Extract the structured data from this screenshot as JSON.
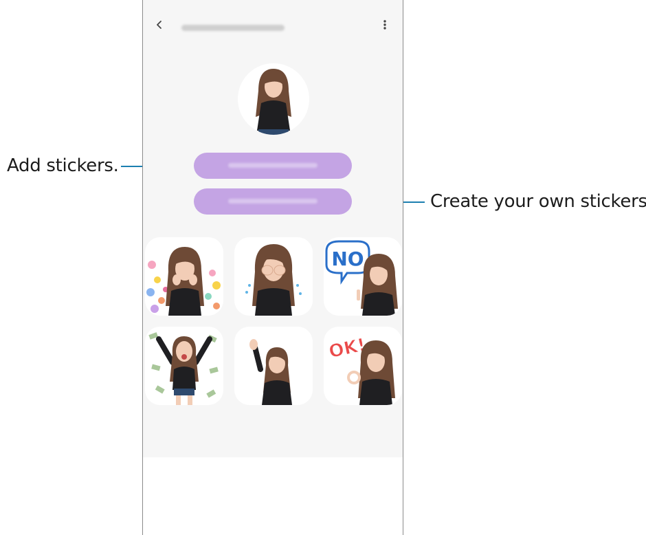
{
  "callouts": {
    "add_stickers": "Add stickers.",
    "create_own": "Create your own stickers."
  },
  "header": {
    "back_icon": "chevron-left-icon",
    "more_icon": "more-vertical-icon"
  },
  "buttons": [
    {
      "id": "add-stickers",
      "color": "#c4a4e4"
    },
    {
      "id": "create-stickers",
      "color": "#c4a4e4"
    }
  ],
  "stickers": [
    {
      "name": "hearts"
    },
    {
      "name": "crying"
    },
    {
      "name": "no",
      "text": "NO"
    },
    {
      "name": "money"
    },
    {
      "name": "wave"
    },
    {
      "name": "ok",
      "text": "OK!"
    }
  ],
  "colors": {
    "leader_line": "#1b7fb0",
    "screen_bg": "#f6f6f6",
    "pill": "#c4a4e4",
    "hair": "#6e4a36",
    "shirt": "#1f1f22"
  }
}
